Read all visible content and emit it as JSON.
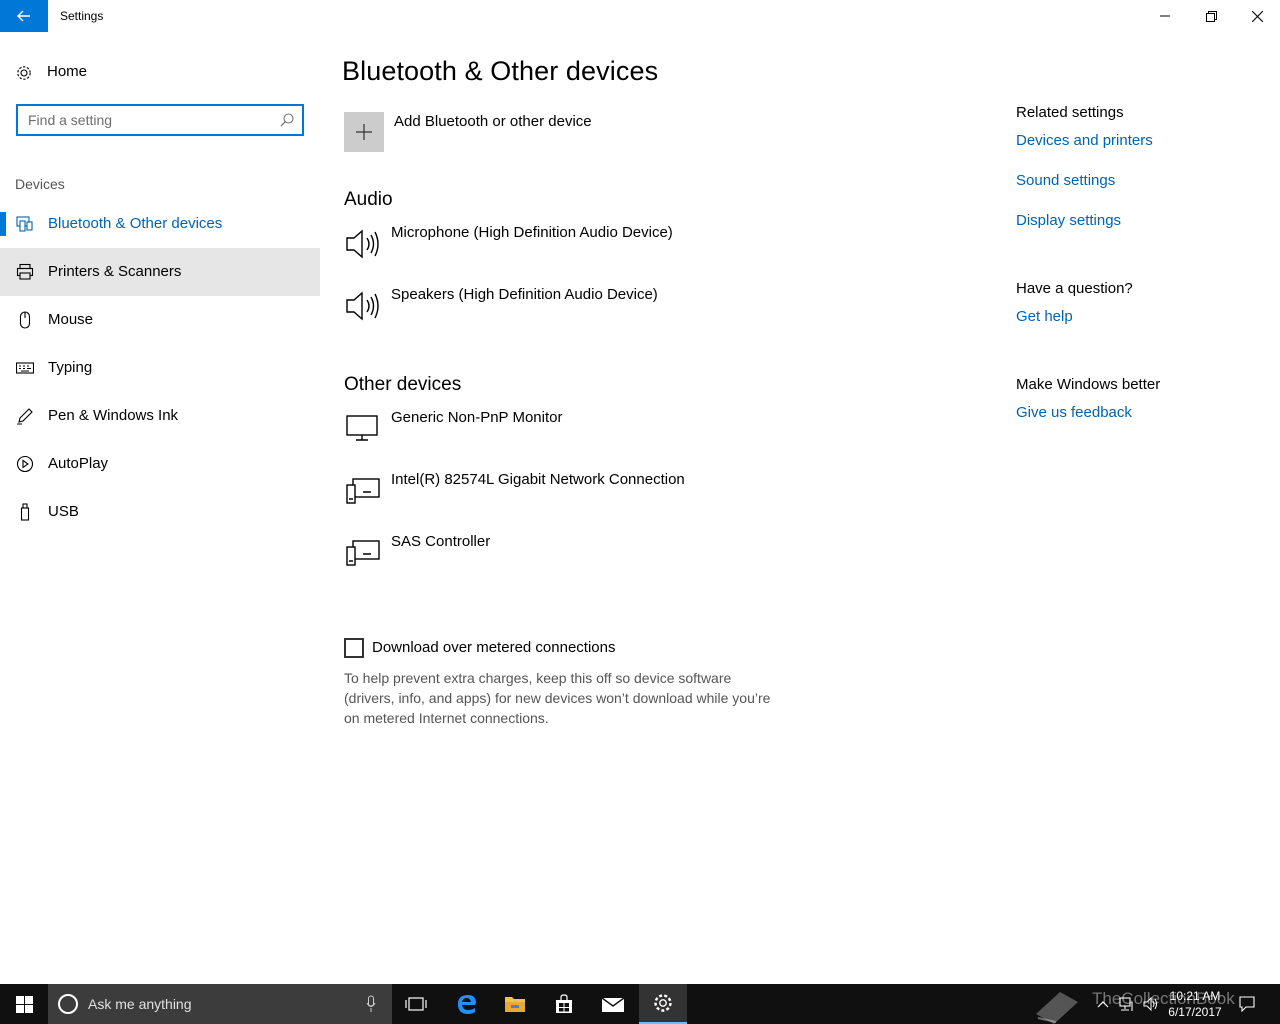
{
  "window": {
    "title": "Settings",
    "accent": "#0078d7",
    "link_color": "#0063b1"
  },
  "sidebar": {
    "home_label": "Home",
    "search_placeholder": "Find a setting",
    "section_label": "Devices",
    "items": [
      {
        "label": "Bluetooth & Other devices",
        "icon": "bluetooth-devices-icon",
        "state": "selected"
      },
      {
        "label": "Printers & Scanners",
        "icon": "printer-icon",
        "state": "hover"
      },
      {
        "label": "Mouse",
        "icon": "mouse-icon",
        "state": "normal"
      },
      {
        "label": "Typing",
        "icon": "keyboard-icon",
        "state": "normal"
      },
      {
        "label": "Pen & Windows Ink",
        "icon": "pen-icon",
        "state": "normal"
      },
      {
        "label": "AutoPlay",
        "icon": "autoplay-icon",
        "state": "normal"
      },
      {
        "label": "USB",
        "icon": "usb-icon",
        "state": "normal"
      }
    ]
  },
  "main": {
    "title": "Bluetooth & Other devices",
    "add_device_label": "Add Bluetooth or other device",
    "groups": [
      {
        "title": "Audio",
        "devices": [
          {
            "name": "Microphone (High Definition Audio Device)",
            "icon": "speaker-icon"
          },
          {
            "name": "Speakers (High Definition Audio Device)",
            "icon": "speaker-icon"
          }
        ]
      },
      {
        "title": "Other devices",
        "devices": [
          {
            "name": "Generic Non-PnP Monitor",
            "icon": "monitor-icon"
          },
          {
            "name": "Intel(R) 82574L Gigabit Network Connection",
            "icon": "generic-device-icon"
          },
          {
            "name": "SAS Controller",
            "icon": "generic-device-icon"
          }
        ]
      }
    ],
    "metered": {
      "label": "Download over metered connections",
      "checked": false,
      "help_text": "To help prevent extra charges, keep this off so device software (drivers, info, and apps) for new devices won’t download while you’re on metered Internet connections."
    }
  },
  "related": {
    "heading": "Related settings",
    "links": [
      "Devices and printers",
      "Sound settings",
      "Display settings"
    ],
    "question_heading": "Have a question?",
    "help_link": "Get help",
    "better_heading": "Make Windows better",
    "feedback_link": "Give us feedback"
  },
  "taskbar": {
    "search_placeholder": "Ask me anything",
    "time": "10:21 AM",
    "date": "6/17/2017",
    "watermark": "TheCollectionBook",
    "pinned": [
      "task-view-icon",
      "edge-icon",
      "file-explorer-icon",
      "store-icon",
      "mail-icon",
      "settings-icon"
    ]
  }
}
